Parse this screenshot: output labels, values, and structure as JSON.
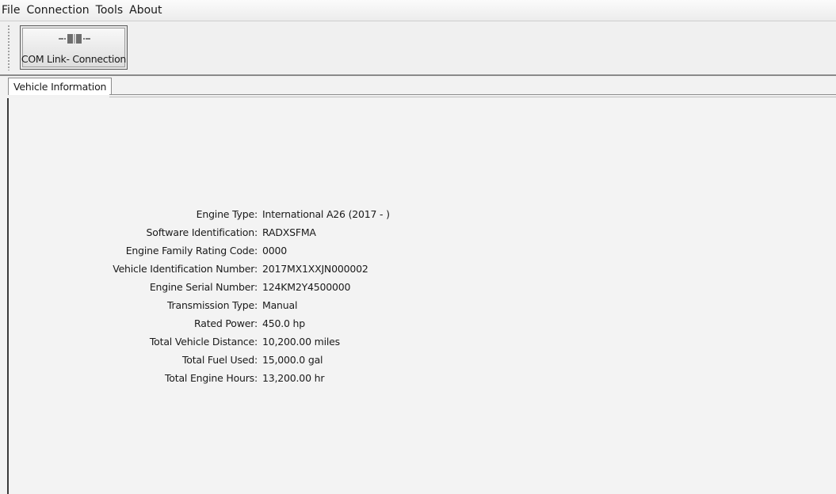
{
  "menu": {
    "items": [
      "File",
      "Connection",
      "Tools",
      "About"
    ]
  },
  "toolbar": {
    "com_link_label": "COM Link- Connection",
    "com_link_icon": "connector-plug-icon"
  },
  "tabs": [
    {
      "label": "Vehicle Information",
      "active": true
    }
  ],
  "vehicle_info": [
    {
      "label": "Engine Type:",
      "value": "International A26 (2017 - )"
    },
    {
      "label": "Software Identification:",
      "value": "RADXSFMA"
    },
    {
      "label": "Engine Family Rating Code:",
      "value": "0000"
    },
    {
      "label": "Vehicle Identification Number:",
      "value": "2017MX1XXJN000002"
    },
    {
      "label": "Engine Serial Number:",
      "value": "124KM2Y4500000"
    },
    {
      "label": "Transmission Type:",
      "value": "Manual"
    },
    {
      "label": "Rated Power:",
      "value": "450.0 hp"
    },
    {
      "label": "Total Vehicle Distance:",
      "value": "10,200.00 miles"
    },
    {
      "label": "Total Fuel Used:",
      "value": "15,000.0 gal"
    },
    {
      "label": "Total Engine Hours:",
      "value": "13,200.00 hr"
    }
  ]
}
